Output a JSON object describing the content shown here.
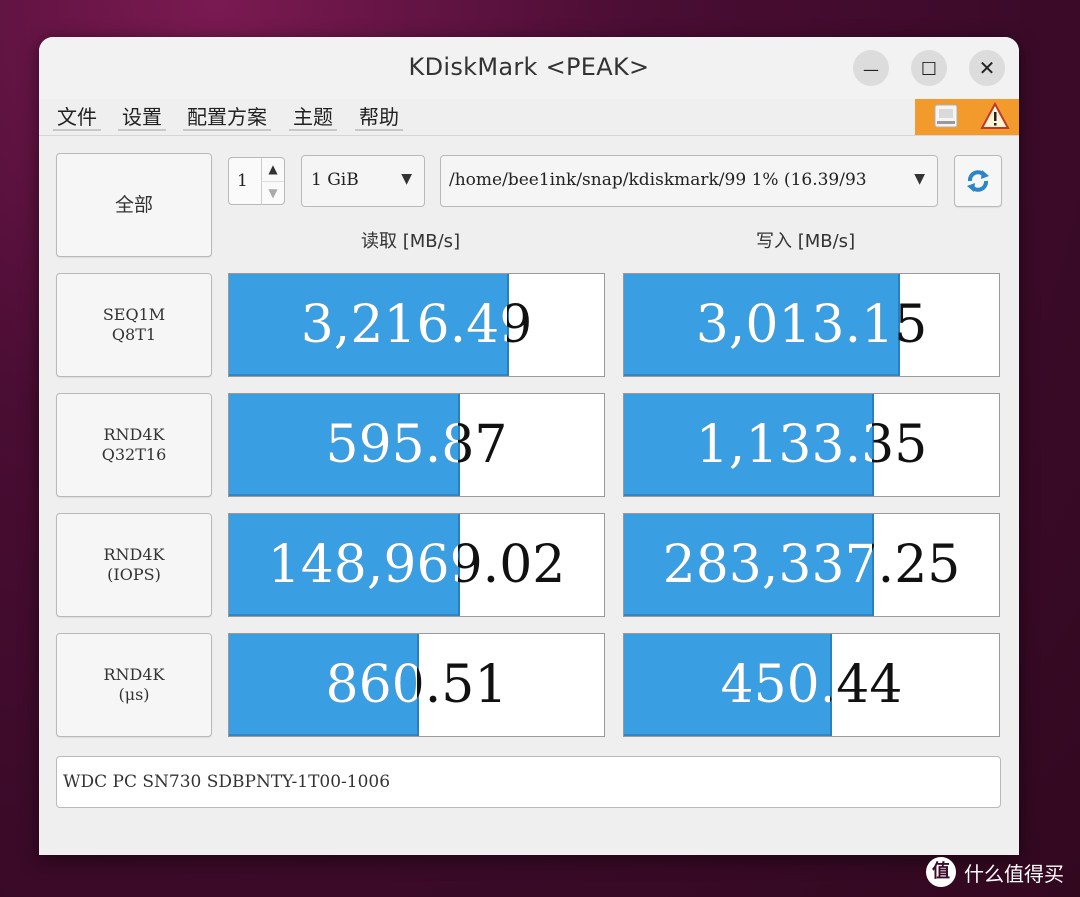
{
  "window": {
    "title": "KDiskMark <PEAK>"
  },
  "titlebar_buttons": {
    "minimize": "—",
    "maximize": "☐",
    "close": "✕"
  },
  "menu": {
    "items": [
      "文件",
      "设置",
      "配置方案",
      "主题",
      "帮助"
    ]
  },
  "controls": {
    "all_button": "全部",
    "runs": "1",
    "size": "1 GiB",
    "path": "/home/bee1ink/snap/kdiskmark/99 1% (16.39/93"
  },
  "columns": {
    "read": "读取 [MB/s]",
    "write": "写入 [MB/s]"
  },
  "tests": [
    {
      "label_line1": "SEQ1M",
      "label_line2": "Q8T1",
      "read": "3,216.49",
      "read_fill": 0.74,
      "write": "3,013.15",
      "write_fill": 0.73
    },
    {
      "label_line1": "RND4K",
      "label_line2": "Q32T16",
      "read": "595.87",
      "read_fill": 0.61,
      "write": "1,133.35",
      "write_fill": 0.66
    },
    {
      "label_line1": "RND4K",
      "label_line2": "(IOPS)",
      "read": "148,969.02",
      "read_fill": 0.61,
      "write": "283,337.25",
      "write_fill": 0.66
    },
    {
      "label_line1": "RND4K",
      "label_line2": "(μs)",
      "read": "860.51",
      "read_fill": 0.5,
      "write": "450.44",
      "write_fill": 0.55
    }
  ],
  "device": {
    "name": "WDC PC SN730 SDBPNTY-1T00-1006"
  },
  "watermark": {
    "text": "什么值得买",
    "badge": "值"
  },
  "colors": {
    "bar": "#3a9ee2",
    "accent": "#f39a2d",
    "background": "#3a0a28"
  }
}
